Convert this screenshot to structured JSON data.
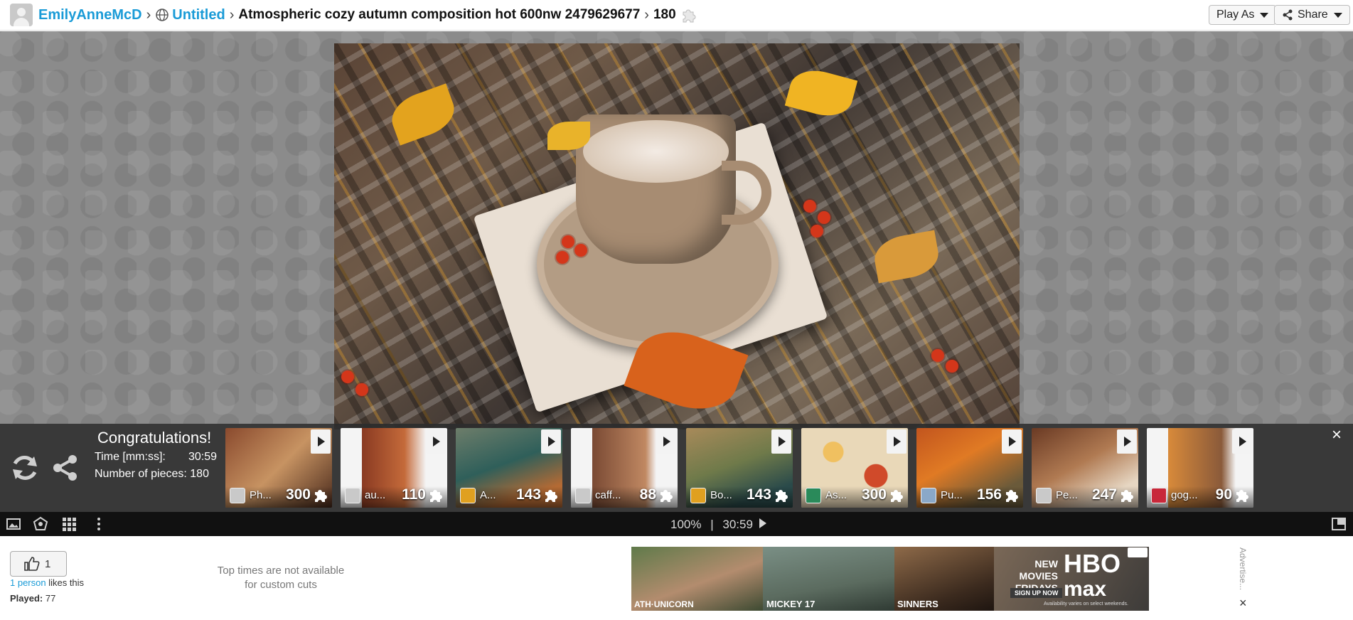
{
  "header": {
    "user": "EmilyAnneMcD",
    "collection": "Untitled",
    "title": "Atmospheric cozy autumn composition hot 600nw 2479629677",
    "pieces": "180",
    "play_as_label": "Play As",
    "share_label": "Share"
  },
  "congrats": {
    "title": "Congratulations!",
    "time_label": "Time [mm:ss]:",
    "time_value": "30:59",
    "pieces_label": "Number of pieces: 180",
    "close": "×"
  },
  "thumbnails": [
    {
      "name": "Ph...",
      "count": "300"
    },
    {
      "name": "au...",
      "count": "110"
    },
    {
      "name": "A...",
      "count": "143"
    },
    {
      "name": "caff...",
      "count": "88"
    },
    {
      "name": "Bo...",
      "count": "143"
    },
    {
      "name": "As...",
      "count": "300"
    },
    {
      "name": "Pu...",
      "count": "156"
    },
    {
      "name": "Pe...",
      "count": "247"
    },
    {
      "name": "gog...",
      "count": "90"
    }
  ],
  "toolbar": {
    "zoom": "100%",
    "separator": "|",
    "timer": "30:59"
  },
  "footer": {
    "like_count": "1",
    "likes_link": "1 person",
    "likes_suffix": " likes this",
    "played_label": "Played:",
    "played_value": "77",
    "top_times_line1": "Top times are not available",
    "top_times_line2": "for custom cuts"
  },
  "ad": {
    "caption1": "ATH·UNICORN",
    "caption2": "MICKEY 17",
    "caption3": "SINNERS",
    "headline": "NEW MOVIES FRIDAYS",
    "logo_line1": "HBO",
    "logo_line2": "max",
    "signup": "SIGN UP NOW",
    "availability": "Availability varies on select weekends.",
    "side_label": "Advertise...",
    "close": "×"
  },
  "colors": {
    "link": "#1a9bd7",
    "congrats_bg": "#2d2d2d",
    "toolbar_bg": "#111111",
    "board_bg": "#8b8b8b"
  }
}
